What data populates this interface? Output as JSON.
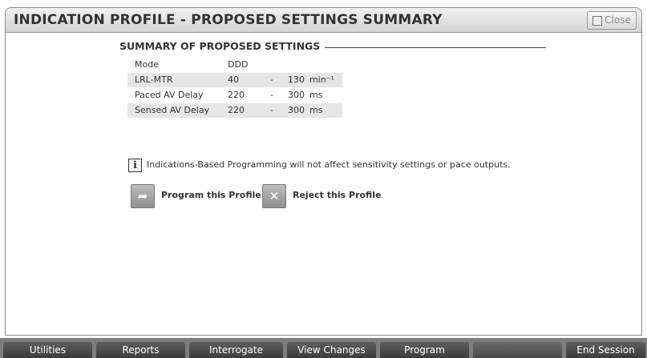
{
  "window": {
    "title": "INDICATION PROFILE - PROPOSED SETTINGS SUMMARY",
    "close_label": "Close"
  },
  "summary": {
    "heading": "SUMMARY OF PROPOSED SETTINGS",
    "rows": [
      {
        "label": "Mode",
        "min": "DDD",
        "dash": "",
        "max": "",
        "unit": ""
      },
      {
        "label": "LRL-MTR",
        "min": "40",
        "dash": "-",
        "max": "130",
        "unit": "min⁻¹"
      },
      {
        "label": "Paced AV Delay",
        "min": "220",
        "dash": "-",
        "max": "300",
        "unit": "ms"
      },
      {
        "label": "Sensed AV Delay",
        "min": "220",
        "dash": "-",
        "max": "300",
        "unit": "ms"
      }
    ]
  },
  "info": {
    "icon": "info-icon",
    "text": "Indications-Based Programming will not affect sensitivity settings or pace outputs."
  },
  "actions": {
    "program_label": "Program this Profile",
    "reject_label": "Reject this Profile"
  },
  "tabs": [
    "Utilities",
    "Reports",
    "Interrogate",
    "View Changes",
    "Program",
    "",
    "End Session"
  ]
}
